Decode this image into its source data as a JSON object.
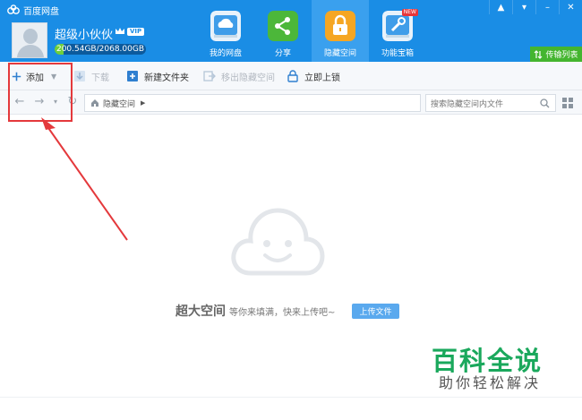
{
  "app": {
    "title": "百度网盘"
  },
  "window_controls": {
    "pin": "▲",
    "menu": "▾",
    "minimize": "–",
    "close": "✕"
  },
  "user": {
    "name": "超级小伙伙",
    "vip": "VIP",
    "quota": "200.54GB/2068.00GB"
  },
  "nav_tabs": [
    {
      "label": "我的网盘",
      "icon": "cloud-drive-icon"
    },
    {
      "label": "分享",
      "icon": "share-icon"
    },
    {
      "label": "隐藏空间",
      "icon": "lock-icon"
    },
    {
      "label": "功能宝箱",
      "icon": "toolbox-icon",
      "badge": "NEW"
    }
  ],
  "transfer_list": "传输列表",
  "toolbar": {
    "add": "添加",
    "download": "下载",
    "new_folder": "新建文件夹",
    "move_out": "移出隐藏空间",
    "lock_now": "立即上锁"
  },
  "path": {
    "current": "隐藏空间"
  },
  "search": {
    "placeholder": "搜索隐藏空间内文件"
  },
  "empty_state": {
    "title": "超大空间",
    "message": "等你来填满，快来上传吧~",
    "upload_button": "上传文件"
  },
  "watermark": {
    "title": "百科全说",
    "subtitle": "助你轻松解决"
  },
  "colors": {
    "header": "#1a8de5",
    "accent_green": "#44b52f",
    "highlight": "#e4393c"
  }
}
